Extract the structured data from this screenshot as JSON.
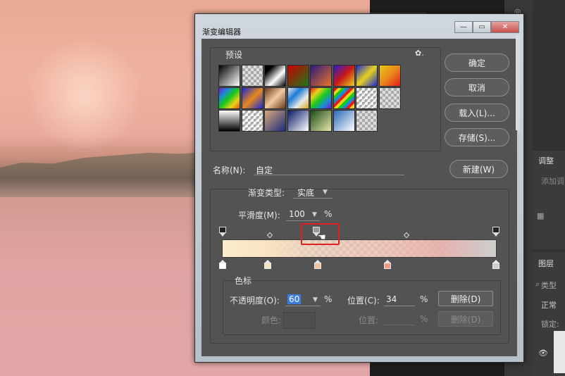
{
  "dialog": {
    "title": "渐变编辑器",
    "win_min": "—",
    "win_max": "▭",
    "win_close": "✕"
  },
  "presets": {
    "label": "预设",
    "gear": "✿.",
    "swatches": [
      "linear-gradient(135deg,#000,#fff)",
      "checker-white",
      "linear-gradient(135deg,#000 20%,#fff 60%,#000 100%)",
      "linear-gradient(135deg,#c00,#1a7a1a)",
      "linear-gradient(135deg,#2b1a7a,#e8742a)",
      "linear-gradient(135deg,#2a1ac8,#c81a1a,#e8d21a)",
      "linear-gradient(135deg,#1a2ad8,#e8d21a,#1a2ad8)",
      "linear-gradient(135deg,#e8c81a,#e8881a,#e81a1a)",
      "linear-gradient(135deg,#7a1ac8,#1a8ad8,#1ac81a,#e8d21a,#e8521a)",
      "linear-gradient(135deg,#1a2ad8,#e8881a,#1a2ad8)",
      "linear-gradient(135deg,#6a3a1a,#f0c8a0,#6a3a1a)",
      "linear-gradient(135deg,#e8e8e8,#1a7ad8,#e8e8e8,#d8a81a)",
      "linear-gradient(135deg,#e81a1a,#e8d21a,#1ac81a,#1a8ad8,#7a1ac8)",
      "repeating-linear-gradient(135deg,#e81a1a 0 4px,#e8d21a 4px 8px,#1ac81a 8px 12px,#1a8ad8 12px 16px)",
      "checker-stripe",
      "checker-white",
      "linear-gradient(180deg,#fff,#000)",
      "checker-stripe",
      "linear-gradient(135deg,#d8a878,#1a2a7a)",
      "linear-gradient(135deg,#0a1a6a,#fff)",
      "linear-gradient(135deg,#1a4a1a,#e8e8a8)",
      "linear-gradient(135deg,#2a6ab8,#fff)",
      "checker-white"
    ]
  },
  "buttons": {
    "ok": "确定",
    "cancel": "取消",
    "load": "载入(L)...",
    "save": "存储(S)...",
    "new": "新建(W)"
  },
  "name": {
    "label": "名称(N):",
    "value": "自定"
  },
  "gradient_type": {
    "label": "渐变类型:",
    "value": "实底"
  },
  "smoothness": {
    "label": "平滑度(M):",
    "value": "100",
    "unit": "%"
  },
  "stops": {
    "group_label": "色标",
    "opacity_label": "不透明度(O):",
    "opacity_value": "60",
    "opacity_unit": "%",
    "position_label": "位置(C):",
    "position_value": "34",
    "position_unit": "%",
    "delete_label": "删除(D)",
    "color_label": "颜色:",
    "color_position_label": "位置:",
    "color_position_unit": "%",
    "color_delete_label": "删除(D)",
    "color_stop_fills": [
      "#ffffff",
      "#f3e3c2",
      "#f2c29c",
      "#ee9c86",
      "#cfcfcf"
    ]
  },
  "right_panel": {
    "adjust_tab": "调整",
    "adjust_hint": "添加调",
    "layers_tab": "图层",
    "search_hint": "类型",
    "blend_mode": "正常",
    "lock_label": "锁定:"
  }
}
